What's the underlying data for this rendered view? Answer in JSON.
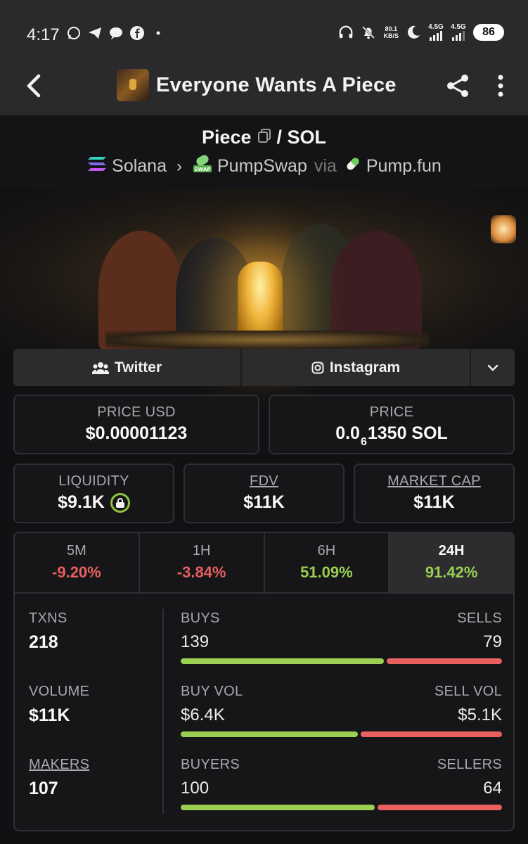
{
  "status_bar": {
    "time": "4:17",
    "speed": "80.1\nKB/S",
    "net1": "4.5G",
    "net2": "4.5G",
    "battery": "86"
  },
  "app_bar": {
    "title": "Everyone Wants A Piece"
  },
  "pair": {
    "base": "Piece",
    "separator": "/ SOL",
    "chain": "Solana",
    "dex": "PumpSwap",
    "via": "via",
    "launchpad": "Pump.fun"
  },
  "socials": {
    "twitter": "Twitter",
    "instagram": "Instagram"
  },
  "price": {
    "usd_label": "PRICE USD",
    "usd_value": "$0.00001123",
    "native_label": "PRICE",
    "native_prefix": "0.0",
    "native_zeros": "6",
    "native_digits": "1350 SOL"
  },
  "liquidity": {
    "label": "LIQUIDITY",
    "value": "$9.1K"
  },
  "fdv": {
    "label": "FDV",
    "value": "$11K"
  },
  "market_cap": {
    "label": "MARKET CAP",
    "value": "$11K"
  },
  "timeframes": [
    {
      "label": "5M",
      "change": "-9.20%"
    },
    {
      "label": "1H",
      "change": "-3.84%"
    },
    {
      "label": "6H",
      "change": "51.09%"
    },
    {
      "label": "24H",
      "change": "91.42%"
    }
  ],
  "active_timeframe": "24H",
  "metrics": {
    "txns_label": "TXNS",
    "txns_value": "218",
    "volume_label": "VOLUME",
    "volume_value": "$11K",
    "makers_label": "MAKERS",
    "makers_value": "107"
  },
  "split": {
    "buys_label": "BUYS",
    "sells_label": "SELLS",
    "buys": "139",
    "sells": "79",
    "buys_ratio": 0.638,
    "buy_vol_label": "BUY VOL",
    "sell_vol_label": "SELL VOL",
    "buy_vol": "$6.4K",
    "sell_vol": "$5.1K",
    "buy_vol_ratio": 0.557,
    "buyers_label": "BUYERS",
    "sellers_label": "SELLERS",
    "buyers": "100",
    "sellers": "64",
    "buyers_ratio": 0.61
  },
  "colors": {
    "positive": "#9bcf52",
    "negative": "#ea5f5f"
  }
}
